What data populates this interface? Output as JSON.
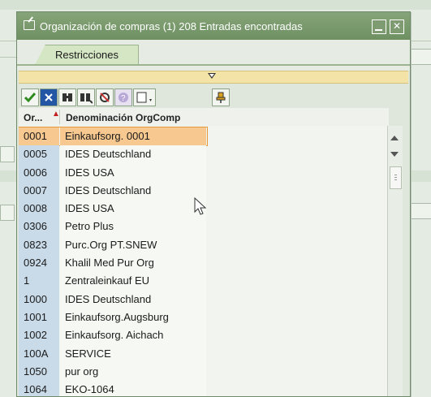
{
  "window": {
    "title": "Organización de compras (1)  208 Entradas encontradas"
  },
  "tabs": [
    {
      "label": "Restricciones"
    }
  ],
  "toolbar": {
    "icons": [
      "check-icon",
      "cancel-icon",
      "find-icon",
      "find-next-icon",
      "sort-icon",
      "info-icon",
      "print-icon",
      "pin-icon"
    ]
  },
  "table": {
    "columns": [
      {
        "label": "Or..."
      },
      {
        "label": "Denominación OrgComp"
      }
    ],
    "rows": [
      {
        "key": "0001",
        "name": "Einkaufsorg. 0001",
        "selected": true
      },
      {
        "key": "0005",
        "name": "IDES Deutschland"
      },
      {
        "key": "0006",
        "name": "IDES USA"
      },
      {
        "key": "0007",
        "name": "IDES Deutschland"
      },
      {
        "key": "0008",
        "name": "IDES USA"
      },
      {
        "key": "0306",
        "name": "Petro Plus"
      },
      {
        "key": "0823",
        "name": "Purc.Org PT.SNEW"
      },
      {
        "key": "0924",
        "name": "Khalil Med Pur Org"
      },
      {
        "key": "1",
        "name": "Zentraleinkauf EU"
      },
      {
        "key": "1000",
        "name": "IDES Deutschland"
      },
      {
        "key": "1001",
        "name": "Einkaufsorg.Augsburg"
      },
      {
        "key": "1002",
        "name": "Einkaufsorg. Aichach"
      },
      {
        "key": "100A",
        "name": "SERVICE"
      },
      {
        "key": "1050",
        "name": "pur org"
      },
      {
        "key": "1064",
        "name": "EKO-1064"
      }
    ]
  },
  "colors": {
    "title_bar": "#7a9a6d",
    "selected_row": "#f7c88f",
    "key_column": "#c9dbe9",
    "collapse_bar": "#f4e3a6"
  }
}
